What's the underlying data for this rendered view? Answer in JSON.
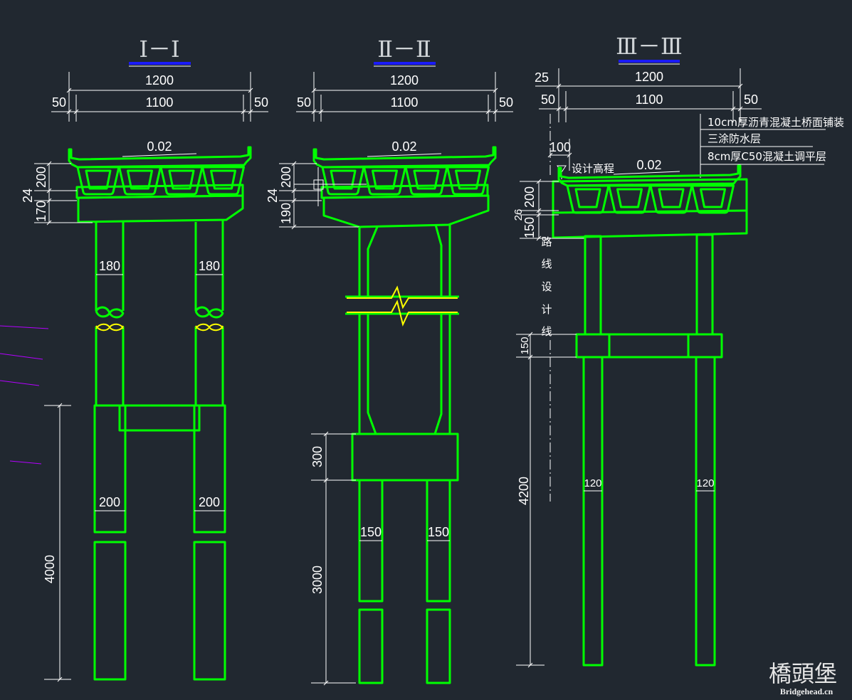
{
  "canvas": {
    "background": "#212830"
  },
  "colors": {
    "structure": "#00ff00",
    "dimension": "#ffffff",
    "break_line": "#ffff00",
    "title_underline": "#1a1aff",
    "stray_lines": "#b400ff"
  },
  "section1": {
    "title": "Ⅰ－Ⅰ",
    "dim_total": "1200",
    "dim_inner": "1100",
    "dim_left": "50",
    "dim_right": "50",
    "slope": "0.02",
    "dim_girder": "200",
    "dim_bearing": "24",
    "dim_cap": "170",
    "column_left": "180",
    "column_right": "180",
    "pile_left": "200",
    "pile_right": "200",
    "dim_pile_length": "4000"
  },
  "section2": {
    "title": "Ⅱ－Ⅱ",
    "dim_total": "1200",
    "dim_inner": "1100",
    "dim_left": "50",
    "dim_right": "50",
    "slope": "0.02",
    "dim_girder": "200",
    "dim_bearing": "24",
    "dim_cap": "190",
    "pile_left": "150",
    "pile_right": "150",
    "dim_tie_beam": "300",
    "dim_pile_length": "3000"
  },
  "section3": {
    "title": "Ⅲ－Ⅲ",
    "dim_offset": "25",
    "dim_total": "1200",
    "dim_inner": "1100",
    "dim_left": "50",
    "dim_right": "50",
    "dim_curb": "100",
    "elevation_label": "设计高程",
    "slope": "0.02",
    "layers": [
      "10cm厚沥青混凝土桥面铺装",
      "三涂防水层",
      "8cm厚C50混凝土调平层"
    ],
    "dim_girder": "200",
    "dim_bearing": "26",
    "dim_cap": "150",
    "route_line_chars": [
      "路",
      "线",
      "设",
      "计",
      "线"
    ],
    "dim_tie_beam": "150",
    "dim_pile_length": "4200",
    "pile_left": "120",
    "pile_right": "120"
  },
  "watermark": {
    "logo": "橋頭堡",
    "site": "Bridgehead.cn"
  }
}
